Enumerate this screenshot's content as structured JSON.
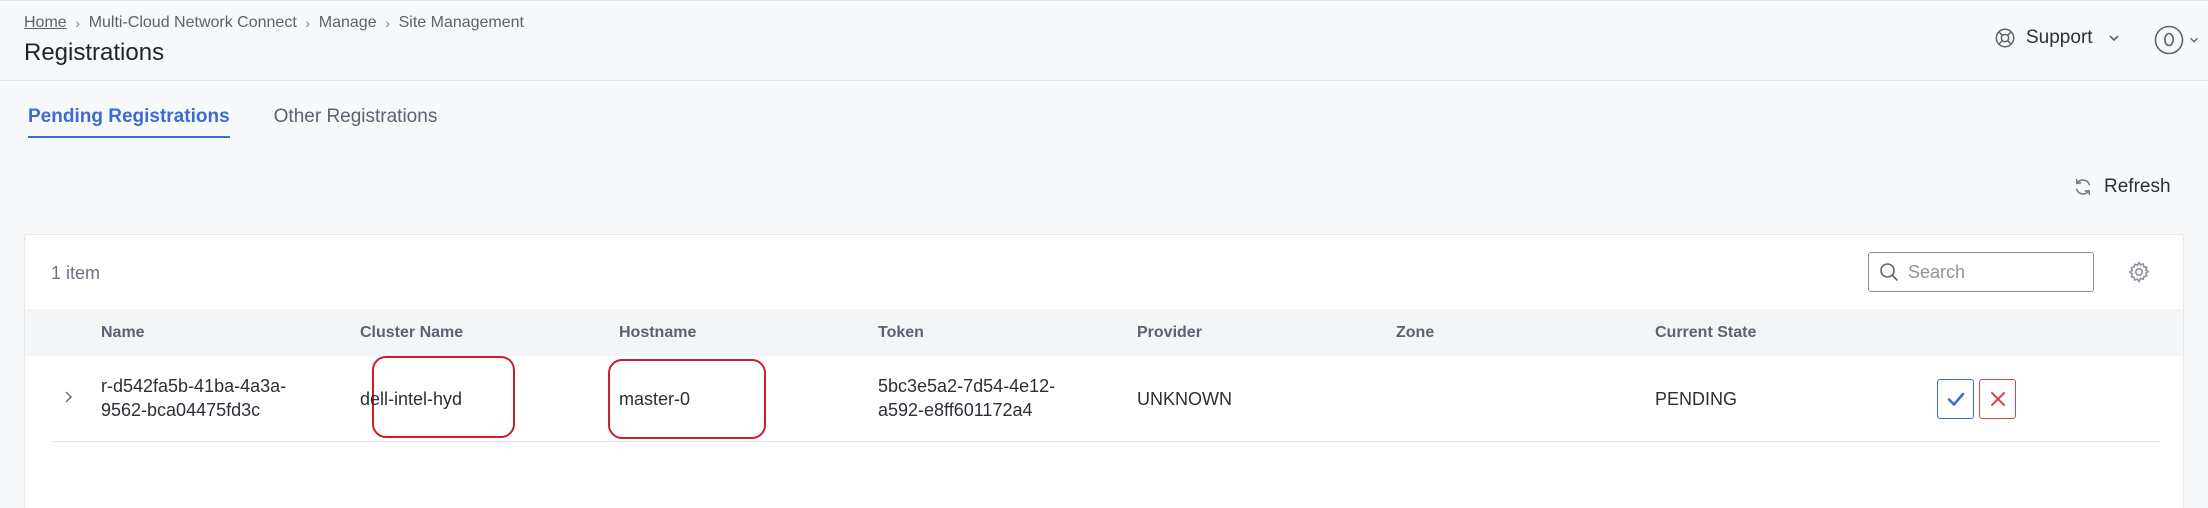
{
  "breadcrumb": {
    "home": "Home",
    "items": [
      "Multi-Cloud Network Connect",
      "Manage",
      "Site Management"
    ]
  },
  "page": {
    "title": "Registrations"
  },
  "header": {
    "support_label": "Support"
  },
  "tabs": [
    {
      "label": "Pending Registrations",
      "active": true
    },
    {
      "label": "Other Registrations",
      "active": false
    }
  ],
  "toolbar": {
    "refresh_label": "Refresh"
  },
  "table": {
    "item_count": "1 item",
    "search_placeholder": "Search",
    "columns": [
      "Name",
      "Cluster Name",
      "Hostname",
      "Token",
      "Provider",
      "Zone",
      "Current State"
    ],
    "rows": [
      {
        "name_line1": "r-d542fa5b-41ba-4a3a-",
        "name_line2": "9562-bca04475fd3c",
        "cluster_name": "dell-intel-hyd",
        "hostname": "master-0",
        "token_line1": "5bc3e5a2-7d54-4e12-",
        "token_line2": "a592-e8ff601172a4",
        "provider": "UNKNOWN",
        "zone": "",
        "current_state": "PENDING"
      }
    ]
  },
  "colors": {
    "accent": "#3d6bd6",
    "reject": "#d1484f",
    "highlight": "#c8202a"
  }
}
